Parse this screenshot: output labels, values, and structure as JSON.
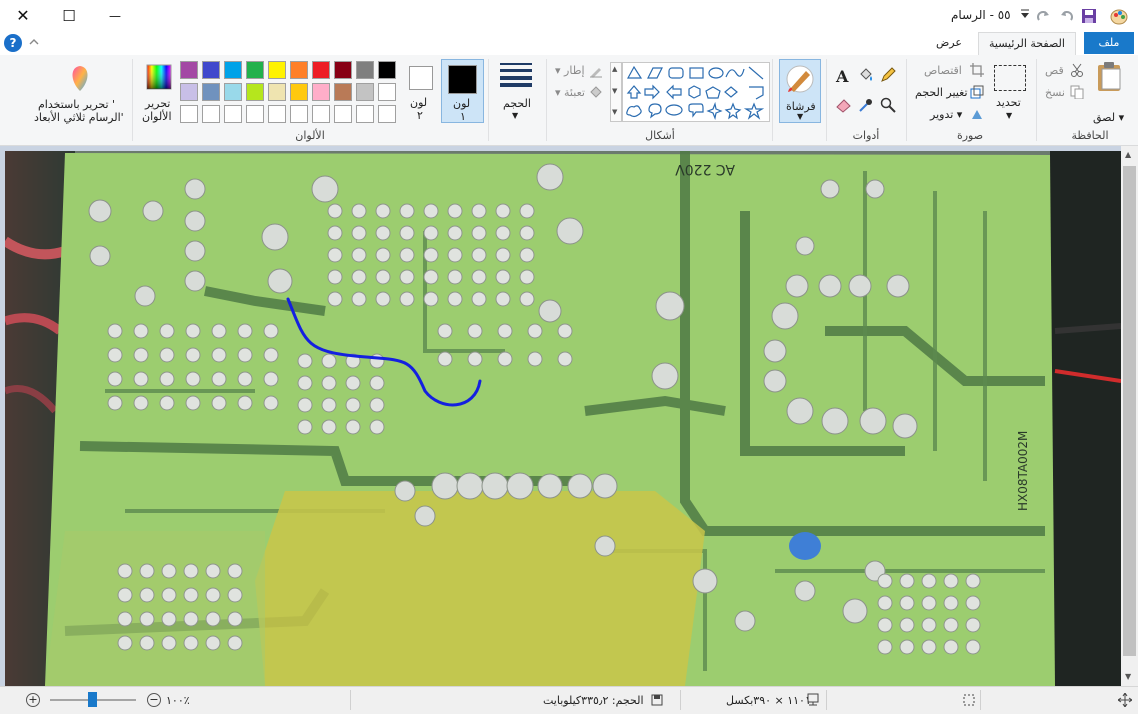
{
  "window": {
    "title": "٥٥ - الرسام",
    "minimize_glyph": "—",
    "maximize_glyph": "☐",
    "close_glyph": "✕"
  },
  "tabs": {
    "file": "ملف",
    "home": "الصفحة الرئيسية",
    "view": "عرض"
  },
  "clipboard": {
    "group_label": "الحافظة",
    "paste_label": "لصق",
    "cut_label": "قص",
    "copy_label": "نسخ"
  },
  "image": {
    "group_label": "صورة",
    "select_label": "تحديد",
    "crop_label": "اقتصاص",
    "resize_label": "تغيير الحجم",
    "rotate_label": "تدوير"
  },
  "tools": {
    "group_label": "أدوات"
  },
  "brushes": {
    "label": "فرشاة"
  },
  "shapes": {
    "group_label": "أشكال",
    "outline_label": "إطار",
    "fill_label": "تعبئة"
  },
  "size": {
    "label": "الحجم"
  },
  "colors": {
    "group_label": "الألوان",
    "color1_label": "لون",
    "color1_num": "١",
    "color2_label": "لون",
    "color2_num": "٢",
    "color1_value": "#000000",
    "color2_value": "#ffffff",
    "edit_colors_line1": "تحرير",
    "edit_colors_line2": "الألوان",
    "paint3d_line1": "تحرير باستخدام '",
    "paint3d_line2": "الرسام ثلاثي الأبعاد'",
    "palette_row1": [
      "#000000",
      "#7f7f7f",
      "#880015",
      "#ed1c24",
      "#ff7f27",
      "#fff200",
      "#22b14c",
      "#00a2e8",
      "#3f48cc",
      "#a349a4"
    ],
    "palette_row2": [
      "#ffffff",
      "#c3c3c3",
      "#b97a57",
      "#ffaec9",
      "#ffc90e",
      "#efe4b0",
      "#b5e61d",
      "#99d9ea",
      "#7092be",
      "#c8bfe7"
    ]
  },
  "status": {
    "dimensions": "١١٠١ × ٣٩٠بكسل",
    "file_size": "الحجم: ٣٣٥٫٢كيلوبايت",
    "zoom": "١٠٠٪"
  },
  "pcb_text": {
    "t1": "AC 220V",
    "t2": "HX08TA002M"
  }
}
